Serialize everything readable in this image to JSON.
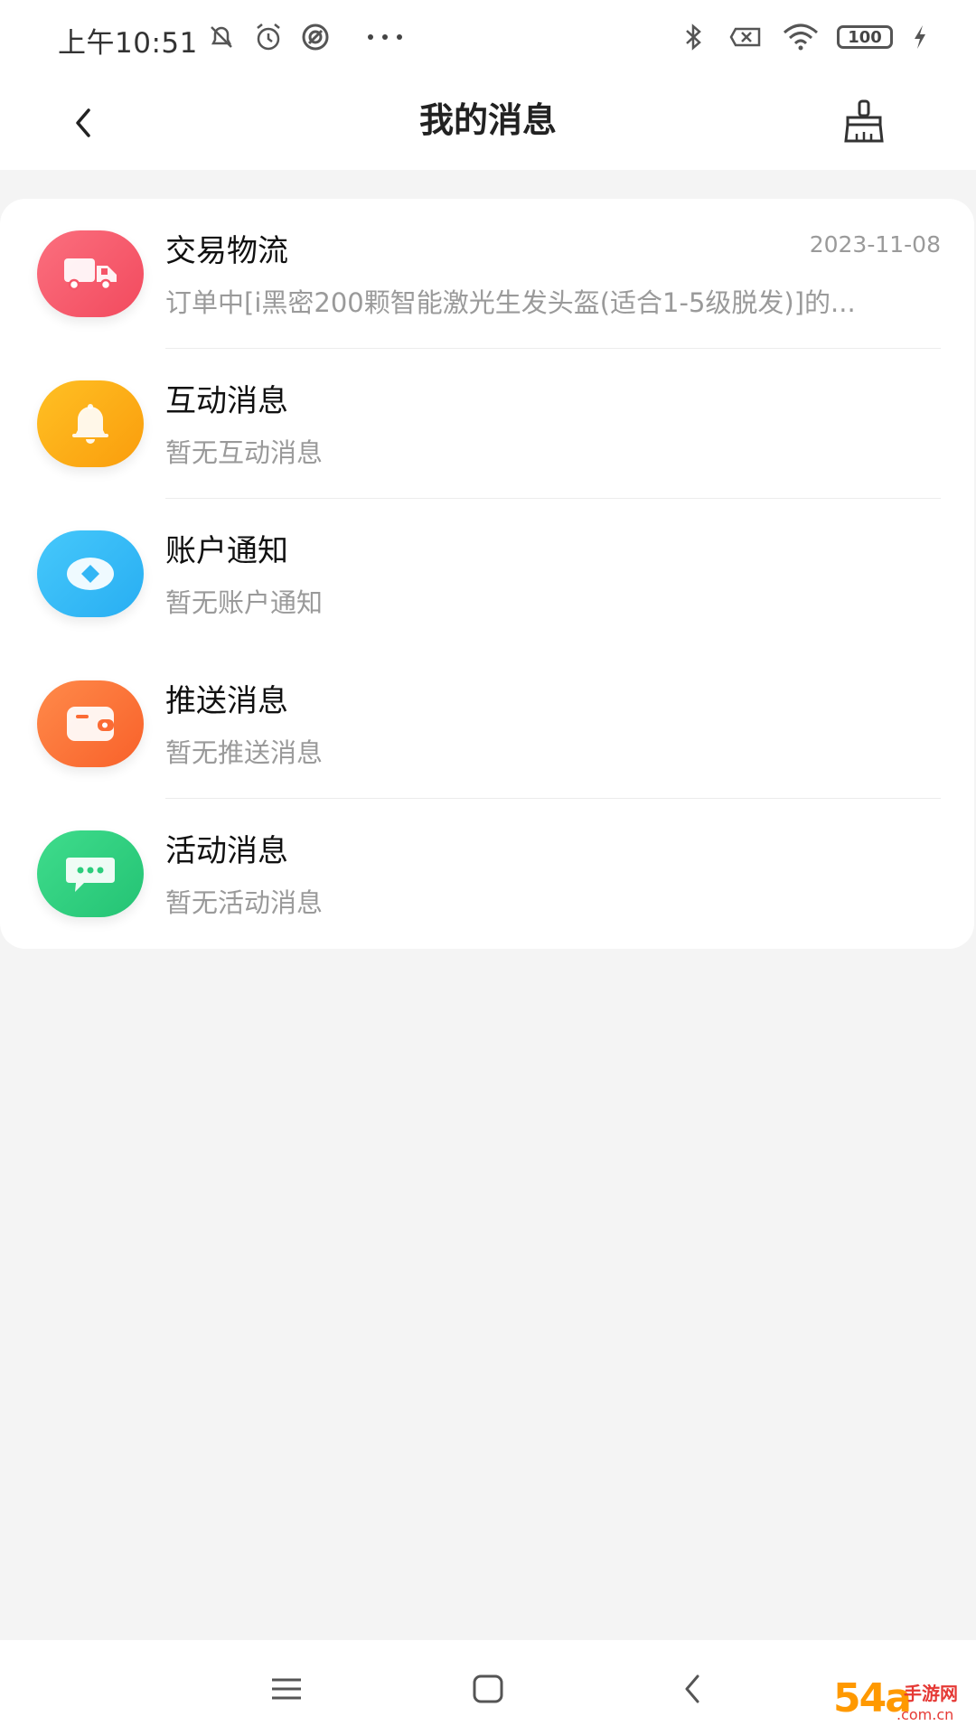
{
  "status_bar": {
    "time": "上午10:51",
    "battery": "100"
  },
  "header": {
    "title": "我的消息"
  },
  "messages": [
    {
      "title": "交易物流",
      "subtitle": "订单中[i黑密200颗智能激光生发头盔(适合1-5级脱发)]的...",
      "date": "2023-11-08",
      "icon": "truck-icon",
      "color": "#f7566a"
    },
    {
      "title": "互动消息",
      "subtitle": "暂无互动消息",
      "date": "",
      "icon": "bell-icon",
      "color": "#fdad18"
    },
    {
      "title": "账户通知",
      "subtitle": "暂无账户通知",
      "date": "",
      "icon": "eye-diamond-icon",
      "color": "#35b8f6"
    },
    {
      "title": "推送消息",
      "subtitle": "暂无推送消息",
      "date": "",
      "icon": "wallet-icon",
      "color": "#fd6f2f"
    },
    {
      "title": "活动消息",
      "subtitle": "暂无活动消息",
      "date": "",
      "icon": "chat-icon",
      "color": "#2ecf7e"
    }
  ],
  "watermark": {
    "main": "54a",
    "side": "手游网",
    "domain": ".com.cn"
  }
}
